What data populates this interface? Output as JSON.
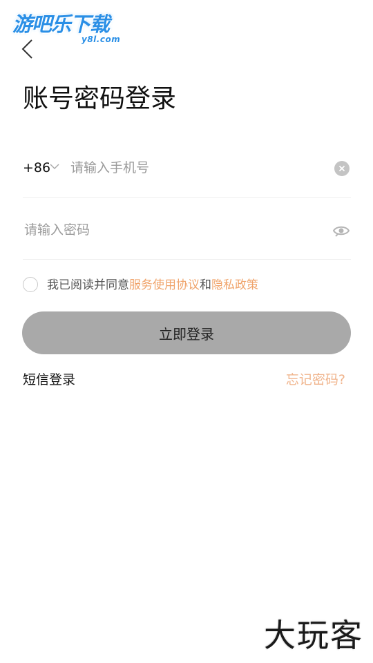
{
  "watermark_top": {
    "main": "游吧乐下载",
    "sub": "y8l.com"
  },
  "header": {
    "title": "账号密码登录"
  },
  "phone": {
    "country_code": "+86",
    "placeholder": "请输入手机号",
    "value": ""
  },
  "password": {
    "placeholder": "请输入密码",
    "value": ""
  },
  "agreement": {
    "prefix": "我已阅读并同意",
    "service_link": "服务使用协议",
    "conjunction": "和",
    "privacy_link": "隐私政策",
    "checked": false
  },
  "actions": {
    "login_label": "立即登录",
    "sms_login": "短信登录",
    "forgot_password": "忘记密码?"
  },
  "watermark_bottom": {
    "text": "大玩客"
  },
  "colors": {
    "accent": "#f0a36a",
    "button_bg": "#a9a9a9",
    "divider": "#eeeeee"
  }
}
